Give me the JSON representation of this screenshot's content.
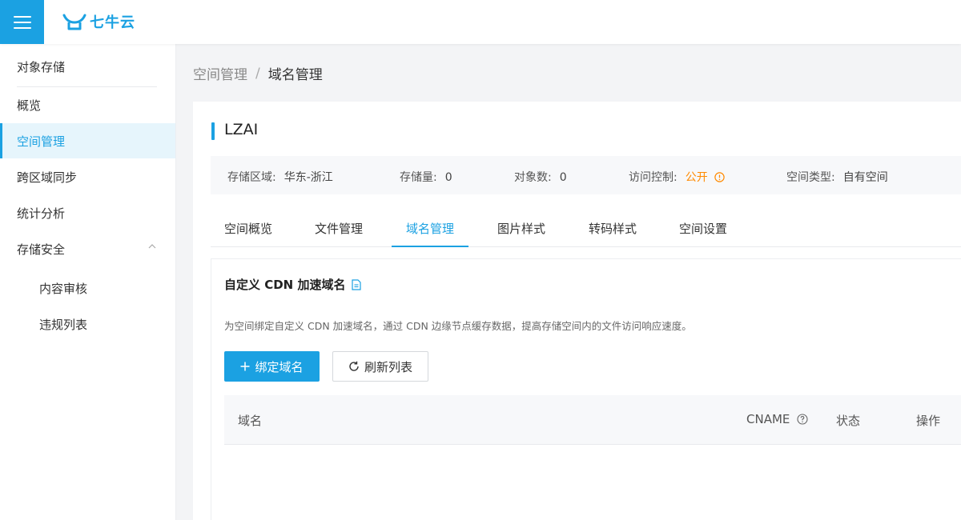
{
  "header": {
    "logo_text": "七牛云",
    "brand_color": "#1ba1e2",
    "menu_icon": "menu-icon"
  },
  "sidebar": {
    "title": "对象存储",
    "items": [
      {
        "label": "概览",
        "active": false
      },
      {
        "label": "空间管理",
        "active": true
      },
      {
        "label": "跨区域同步",
        "active": false
      },
      {
        "label": "统计分析",
        "active": false
      },
      {
        "label": "存储安全",
        "active": false,
        "expanded": true
      }
    ],
    "subitems": [
      {
        "label": "内容审核"
      },
      {
        "label": "违规列表"
      }
    ]
  },
  "breadcrumb": {
    "parent": "空间管理",
    "separator": "/",
    "current": "域名管理"
  },
  "bucket": {
    "name": "LZAI",
    "info": {
      "region_label": "存储区域:",
      "region_value": "华东-浙江",
      "storage_label": "存储量:",
      "storage_value": "0",
      "objects_label": "对象数:",
      "objects_value": "0",
      "access_label": "访问控制:",
      "access_value": "公开",
      "access_color": "#ff8a00",
      "type_label": "空间类型:",
      "type_value": "自有空间"
    }
  },
  "tabs": [
    {
      "label": "空间概览",
      "active": false
    },
    {
      "label": "文件管理",
      "active": false
    },
    {
      "label": "域名管理",
      "active": true
    },
    {
      "label": "图片样式",
      "active": false
    },
    {
      "label": "转码样式",
      "active": false
    },
    {
      "label": "空间设置",
      "active": false
    }
  ],
  "cdn_panel": {
    "title": "自定义 CDN 加速域名",
    "description": "为空间绑定自定义 CDN 加速域名，通过 CDN 边缘节点缓存数据，提高存储空间内的文件访问响应速度。",
    "bind_button": "绑定域名",
    "refresh_button": "刷新列表",
    "table_headers": {
      "domain": "域名",
      "cname": "CNAME",
      "status": "状态",
      "actions": "操作"
    }
  }
}
